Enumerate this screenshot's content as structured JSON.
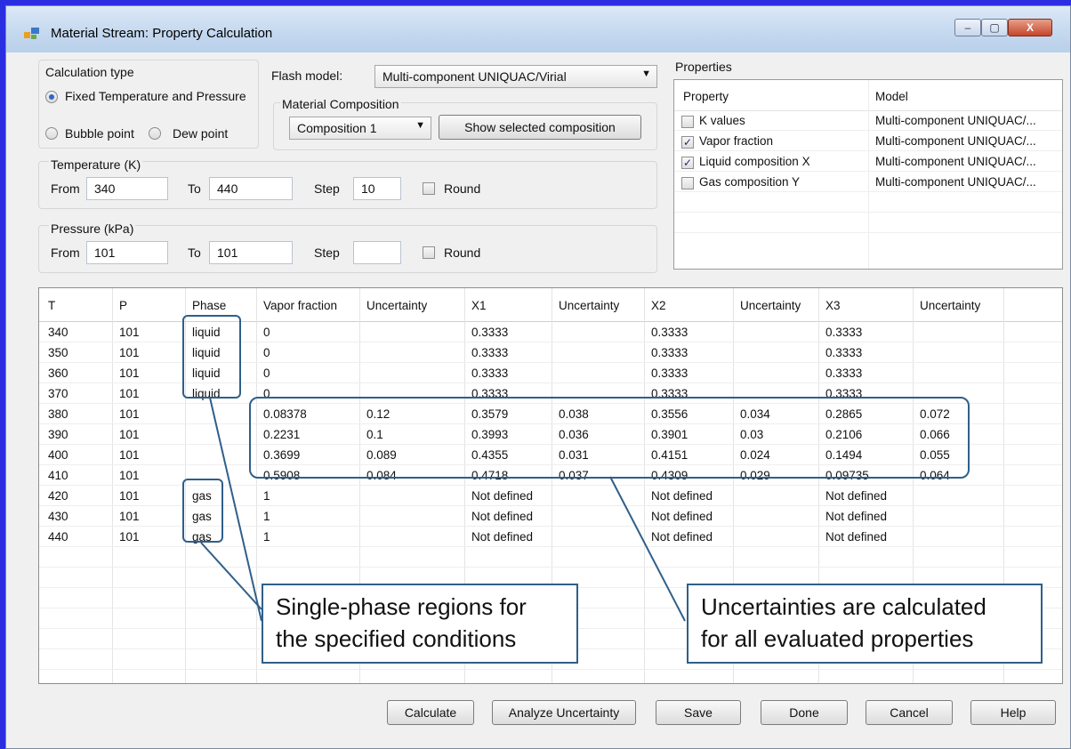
{
  "window": {
    "title": "Material Stream: Property Calculation",
    "controls": {
      "minimize": "–",
      "maximize": "▢",
      "close": "X"
    }
  },
  "calc_type": {
    "label": "Calculation type",
    "options": [
      "Fixed Temperature and Pressure",
      "Bubble point",
      "Dew point"
    ],
    "selected": "Fixed Temperature and Pressure"
  },
  "flash": {
    "label": "Flash model:",
    "value": "Multi-component UNIQUAC/Virial"
  },
  "composition": {
    "label": "Material Composition",
    "value": "Composition 1",
    "show_button": "Show selected composition"
  },
  "temperature": {
    "label": "Temperature (K)",
    "from_label": "From",
    "from": "340",
    "to_label": "To",
    "to": "440",
    "step_label": "Step",
    "step": "10",
    "round_label": "Round"
  },
  "pressure": {
    "label": "Pressure (kPa)",
    "from_label": "From",
    "from": "101",
    "to_label": "To",
    "to": "101",
    "step_label": "Step",
    "step": "",
    "round_label": "Round"
  },
  "properties": {
    "label": "Properties",
    "header": {
      "property": "Property",
      "model": "Model"
    },
    "rows": [
      {
        "name": "K values",
        "checked": false,
        "model": "Multi-component UNIQUAC/..."
      },
      {
        "name": "Vapor fraction",
        "checked": true,
        "model": "Multi-component UNIQUAC/..."
      },
      {
        "name": "Liquid composition X",
        "checked": true,
        "model": "Multi-component UNIQUAC/..."
      },
      {
        "name": "Gas composition Y",
        "checked": false,
        "model": "Multi-component UNIQUAC/..."
      }
    ]
  },
  "grid": {
    "headers": [
      "T",
      "P",
      "Phase",
      "Vapor fraction",
      "Uncertainty",
      "X1",
      "Uncertainty",
      "X2",
      "Uncertainty",
      "X3",
      "Uncertainty"
    ],
    "rows": [
      [
        "340",
        "101",
        "liquid",
        "0",
        "",
        "0.3333",
        "",
        "0.3333",
        "",
        "0.3333",
        ""
      ],
      [
        "350",
        "101",
        "liquid",
        "0",
        "",
        "0.3333",
        "",
        "0.3333",
        "",
        "0.3333",
        ""
      ],
      [
        "360",
        "101",
        "liquid",
        "0",
        "",
        "0.3333",
        "",
        "0.3333",
        "",
        "0.3333",
        ""
      ],
      [
        "370",
        "101",
        "liquid",
        "0",
        "",
        "0.3333",
        "",
        "0.3333",
        "",
        "0.3333",
        ""
      ],
      [
        "380",
        "101",
        "",
        "0.08378",
        "0.12",
        "0.3579",
        "0.038",
        "0.3556",
        "0.034",
        "0.2865",
        "0.072"
      ],
      [
        "390",
        "101",
        "",
        "0.2231",
        "0.1",
        "0.3993",
        "0.036",
        "0.3901",
        "0.03",
        "0.2106",
        "0.066"
      ],
      [
        "400",
        "101",
        "",
        "0.3699",
        "0.089",
        "0.4355",
        "0.031",
        "0.4151",
        "0.024",
        "0.1494",
        "0.055"
      ],
      [
        "410",
        "101",
        "",
        "0.5908",
        "0.084",
        "0.4718",
        "0.037",
        "0.4309",
        "0.029",
        "0.09735",
        "0.064"
      ],
      [
        "420",
        "101",
        "gas",
        "1",
        "",
        "Not defined",
        "",
        "Not defined",
        "",
        "Not defined",
        ""
      ],
      [
        "430",
        "101",
        "gas",
        "1",
        "",
        "Not defined",
        "",
        "Not defined",
        "",
        "Not defined",
        ""
      ],
      [
        "440",
        "101",
        "gas",
        "1",
        "",
        "Not defined",
        "",
        "Not defined",
        "",
        "Not defined",
        ""
      ]
    ]
  },
  "annotations": {
    "left": [
      "Single-phase regions for",
      "the specified conditions"
    ],
    "right": [
      "Uncertainties are calculated",
      "for all evaluated properties"
    ]
  },
  "buttons": {
    "calculate": "Calculate",
    "analyze": "Analyze Uncertainty",
    "save": "Save",
    "done": "Done",
    "cancel": "Cancel",
    "help": "Help"
  },
  "colors": {
    "frame": "#2a2ee0",
    "callout": "#2f5f8a",
    "window_bg": "#f0f0f0"
  }
}
